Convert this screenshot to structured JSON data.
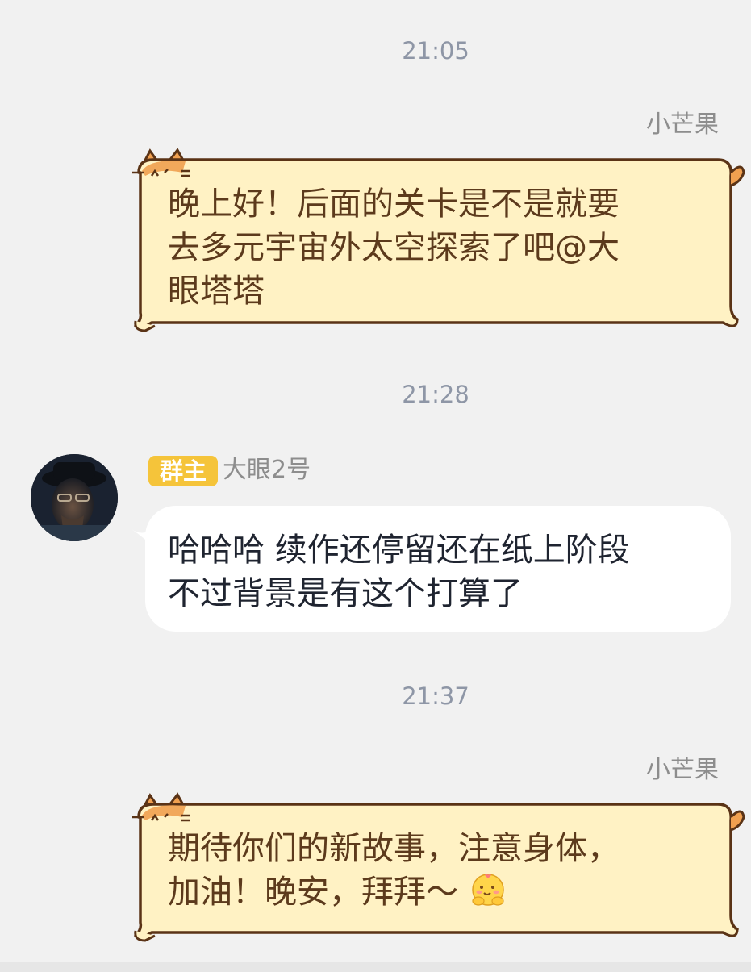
{
  "messages": [
    {
      "type": "timestamp",
      "text": "21:05"
    },
    {
      "type": "outgoing",
      "sender": "小芒果",
      "lines": [
        "晚上好！后面的关卡是不是就要",
        "去多元宇宙外太空探索了吧@大",
        "眼塔塔"
      ]
    },
    {
      "type": "timestamp",
      "text": "21:28"
    },
    {
      "type": "incoming",
      "role_badge": "群主",
      "sender": "大眼2号",
      "lines": [
        "哈哈哈 续作还停留还在纸上阶段",
        "不过背景是有这个打算了"
      ]
    },
    {
      "type": "timestamp",
      "text": "21:37"
    },
    {
      "type": "outgoing",
      "sender": "小芒果",
      "lines": [
        "期待你们的新故事，注意身体，",
        "加油！晚安，拜拜～"
      ],
      "emoji": "hug-emoji"
    }
  ],
  "colors": {
    "page_bg": "#f1f1f1",
    "cat_bubble_fill": "#fff2c4",
    "cat_bubble_stroke": "#5a3316",
    "cat_ear": "#f0a050",
    "badge": "#f5c43a",
    "timestamp": "#8e96a6"
  }
}
